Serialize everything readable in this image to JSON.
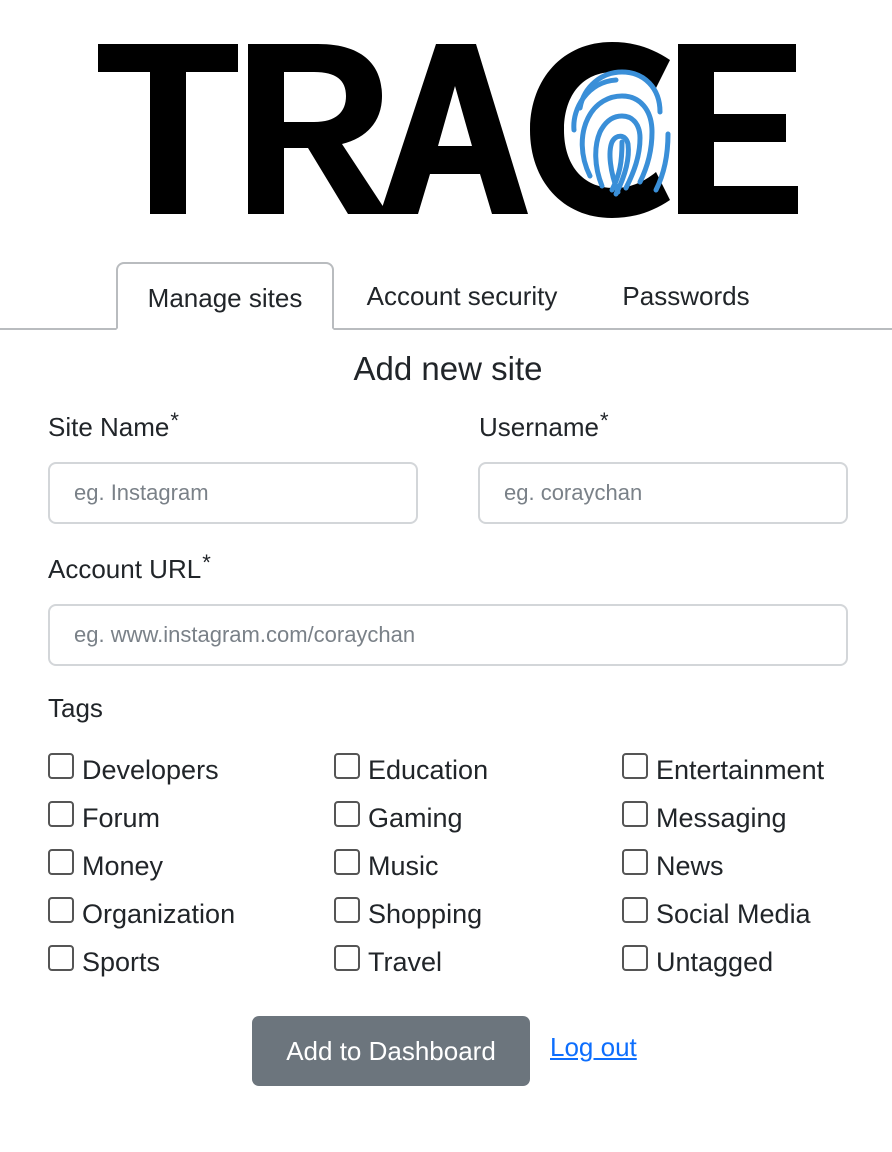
{
  "logo": {
    "text": "TRACE",
    "icon": "fingerprint-icon",
    "icon_color": "#3a8fd8"
  },
  "tabs": [
    {
      "label": "Manage sites",
      "active": true
    },
    {
      "label": "Account security",
      "active": false
    },
    {
      "label": "Passwords",
      "active": false
    }
  ],
  "form": {
    "title": "Add new site",
    "required_mark": "*",
    "site_name": {
      "label": "Site Name",
      "placeholder": "eg. Instagram",
      "value": ""
    },
    "username": {
      "label": "Username",
      "placeholder": "eg. coraychan",
      "value": ""
    },
    "account_url": {
      "label": "Account URL",
      "placeholder": "eg. www.instagram.com/coraychan",
      "value": ""
    },
    "tags_label": "Tags",
    "tags": [
      {
        "label": "Developers",
        "checked": false
      },
      {
        "label": "Education",
        "checked": false
      },
      {
        "label": "Entertainment",
        "checked": false
      },
      {
        "label": "Forum",
        "checked": false
      },
      {
        "label": "Gaming",
        "checked": false
      },
      {
        "label": "Messaging",
        "checked": false
      },
      {
        "label": "Money",
        "checked": false
      },
      {
        "label": "Music",
        "checked": false
      },
      {
        "label": "News",
        "checked": false
      },
      {
        "label": "Organization",
        "checked": false
      },
      {
        "label": "Shopping",
        "checked": false
      },
      {
        "label": "Social Media",
        "checked": false
      },
      {
        "label": "Sports",
        "checked": false
      },
      {
        "label": "Travel",
        "checked": false
      },
      {
        "label": "Untagged",
        "checked": false
      }
    ]
  },
  "actions": {
    "submit_label": "Add to Dashboard",
    "logout_label": "Log out"
  },
  "colors": {
    "button_bg": "#6c757d",
    "link": "#0d6efd",
    "tab_border": "#b9bcbf",
    "input_border": "#d3d6d9"
  }
}
